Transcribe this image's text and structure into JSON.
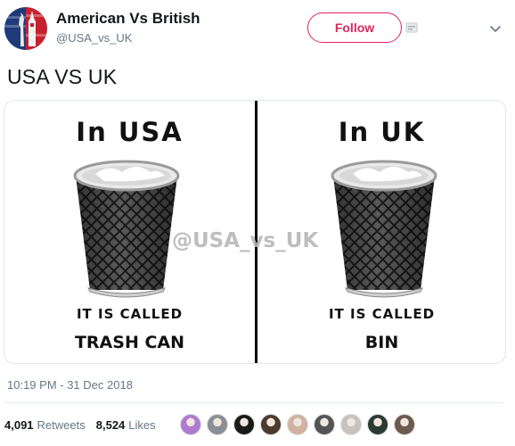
{
  "header": {
    "display_name": "American Vs British",
    "handle": "@USA_vs_UK",
    "follow_label": "Follow",
    "avatar_icon": "usa-uk-landmark-avatar",
    "caret_icon": "chevron-down-icon"
  },
  "tweet": {
    "text": "USA VS UK"
  },
  "media": {
    "left": {
      "title": "In USA",
      "caption": "IT IS CALLED",
      "name": "TRASH CAN"
    },
    "right": {
      "title": "In UK",
      "caption": "IT IS CALLED",
      "name": "BIN"
    },
    "watermark": "@USA_vs_UK"
  },
  "timestamp": "10:19 PM - 31 Dec 2018",
  "stats": {
    "retweets_count": "4,091",
    "retweets_label": "Retweets",
    "likes_count": "8,524",
    "likes_label": "Likes"
  },
  "likers": [
    {
      "name": "liker-avatar-1",
      "color": "#b07ad0"
    },
    {
      "name": "liker-avatar-2",
      "color": "#8a8f96"
    },
    {
      "name": "liker-avatar-3",
      "color": "#1a1a1a"
    },
    {
      "name": "liker-avatar-4",
      "color": "#4a3b2c"
    },
    {
      "name": "liker-avatar-5",
      "color": "#d1b2a0"
    },
    {
      "name": "liker-avatar-6",
      "color": "#555555"
    },
    {
      "name": "liker-avatar-7",
      "color": "#c9c1bb"
    },
    {
      "name": "liker-avatar-8",
      "color": "#2b3b34"
    },
    {
      "name": "liker-avatar-9",
      "color": "#6d5a4e"
    }
  ],
  "colors": {
    "follow": "#e0245e",
    "secondary_text": "#657786",
    "primary_text": "#14171a"
  }
}
